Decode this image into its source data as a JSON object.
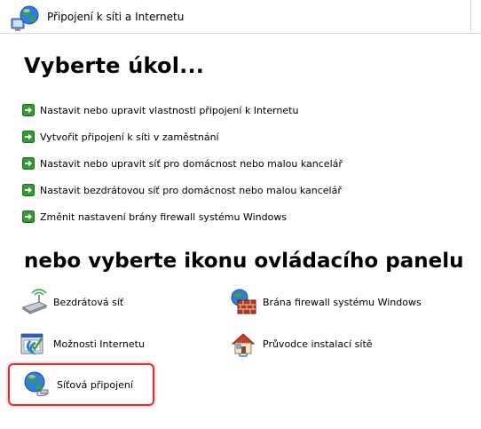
{
  "header": {
    "title": "Připojení k síti a Internetu",
    "icon": "network-globe-icon"
  },
  "tasks_section": {
    "heading": "Vyberte úkol...",
    "items": [
      {
        "label": "Nastavit nebo upravit vlastnosti připojení k Internetu"
      },
      {
        "label": "Vytvořit připojení k síti v zaměstnání"
      },
      {
        "label": "Nastavit nebo upravit síť pro domácnost nebo malou kancelář"
      },
      {
        "label": "Nastavit bezdrátovou síť pro domácnost nebo malou kancelář"
      },
      {
        "label": "Změnit nastavení brány firewall systému Windows"
      }
    ],
    "arrow_color": "#2e9e2e"
  },
  "icons_section": {
    "heading": "nebo vyberte ikonu ovládacího panelu",
    "items": [
      {
        "label": "Bezdrátová síť",
        "icon": "wireless-network-icon"
      },
      {
        "label": "Brána firewall systému Windows",
        "icon": "firewall-icon"
      },
      {
        "label": "Možnosti Internetu",
        "icon": "internet-options-icon"
      },
      {
        "label": "Průvodce instalací sítě",
        "icon": "network-setup-wizard-icon"
      },
      {
        "label": "Síťová připojení",
        "icon": "network-connections-icon"
      }
    ]
  },
  "highlight_color": "#e03030"
}
